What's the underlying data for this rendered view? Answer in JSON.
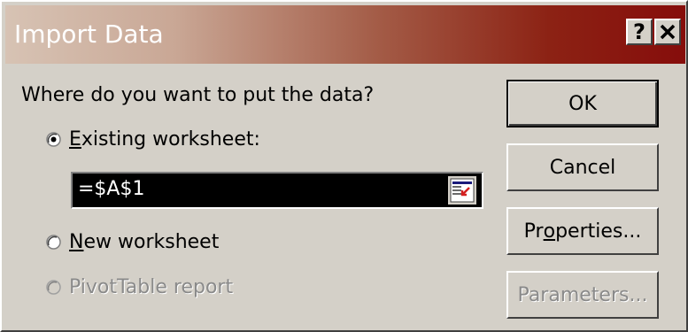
{
  "dialog": {
    "title": "Import Data",
    "help_glyph": "?",
    "question": "Where do you want to put the data?",
    "options": [
      {
        "label_access": "E",
        "label_rest": "xisting worksheet:",
        "selected": true,
        "enabled": true
      },
      {
        "label_access": "N",
        "label_rest": "ew worksheet",
        "selected": false,
        "enabled": true
      },
      {
        "label_full": "PivotTable report",
        "selected": false,
        "enabled": false
      }
    ],
    "reference": {
      "value": "=$A$1"
    },
    "buttons": {
      "ok": "OK",
      "cancel": "Cancel",
      "properties_pre": "Pr",
      "properties_access": "o",
      "properties_post": "perties...",
      "parameters": "Parameters..."
    }
  },
  "colors": {
    "dialog_bg": "#d4d0c8",
    "titlebar_start": "#d7c3b4",
    "titlebar_end": "#860d0b",
    "disabled_text": "#8a8a8a"
  },
  "icons": {
    "help": "help-icon",
    "close": "close-icon",
    "radio_selected": "radio-selected-icon",
    "radio_empty": "radio-empty-icon",
    "collapse_dialog": "collapse-dialog-icon"
  }
}
